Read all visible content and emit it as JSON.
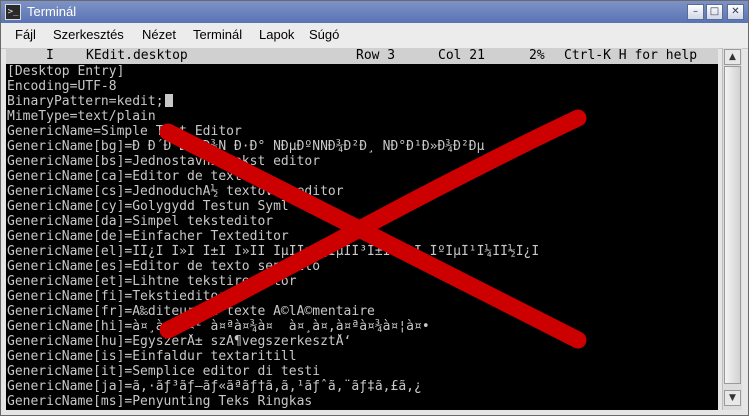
{
  "window": {
    "title": "Terminál",
    "app_icon": "terminal-icon",
    "controls": [
      "minimize-icon",
      "maximize-icon",
      "close-icon"
    ]
  },
  "menubar": {
    "items": [
      "Fájl",
      "Szerkesztés",
      "Nézet",
      "Terminál",
      "Lapok",
      "Súgó"
    ]
  },
  "editor_status": {
    "mode": "I",
    "filename": "KEdit.desktop",
    "row": "Row 3",
    "col": "Col 21",
    "percent": "2%",
    "help_hint": "Ctrl-K H for help"
  },
  "lines": [
    "[Desktop Entry]",
    "Encoding=UTF-8",
    "BinaryPattern=kedit;",
    "MimeType=text/plain",
    "GenericName=Simple Text Editor",
    "GenericName[bg]=Ð Ð´Ð°ÐºÑÐ¾Ñ Ð·Ð° ÑÐµÐºÑÑÐ¾Ð²Ð¸ ÑÐ°Ð¹Ð»Ð¾Ð²Ðµ",
    "GenericName[bs]=Jednostavni tekst editor",
    "GenericName[ca]=Editor de text",
    "GenericName[cs]=JednoduchÃ½ textovÃ½ editor",
    "GenericName[cy]=Golygydd Testun Syml",
    "GenericName[da]=Simpel teksteditor",
    "GenericName[de]=Einfacher Texteditor",
    "GenericName[el]=ÎÎ¿Ï Î»Ï Î±Ï Î»ÏÏ ÎµÏÎµÎ¾ÎµÏÎ³Î±ÏÏÎ®Ï ÎºÎµÎ¹Î¼Î­Î½Î¿Ï ",
    "GenericName[es]=Editor de texto sencillo",
    "GenericName[et]=Lihtne tekstiredaktor",
    "GenericName[fi]=Tekstieditori",
    "GenericName[fr]=Ã‰diteur de texte Ã©lÃ©mentaire",
    "GenericName[hi]=à¤¸à¤°à¤² à¤ªà¤¾à¤  à¤¸à¤‚à¤ªà¤¾à¤¦à¤•",
    "GenericName[hu]=EgyszerÅ± szÃ¶vegszerkesztÅ‘",
    "GenericName[is]=Einfaldur textaritill",
    "GenericName[it]=Semplice editor di testi",
    "GenericName[ja]=ã‚·ãƒ³ãƒ—ãƒ«ãªãƒ†ã‚­ã‚¹ãƒˆã‚¨ãƒ‡ã‚£ã‚¿",
    "GenericName[ms]=Penyunting Teks Ringkas"
  ],
  "cursor_line_index": 2,
  "colors": {
    "terminal_bg": "#000000",
    "terminal_fg": "#c8c8c8",
    "status_bg": "#d0d0d0",
    "titlebar": "#6a82bd",
    "overlay_x": "#cc0000"
  },
  "overlay": {
    "icon": "red-x-mark-icon"
  }
}
